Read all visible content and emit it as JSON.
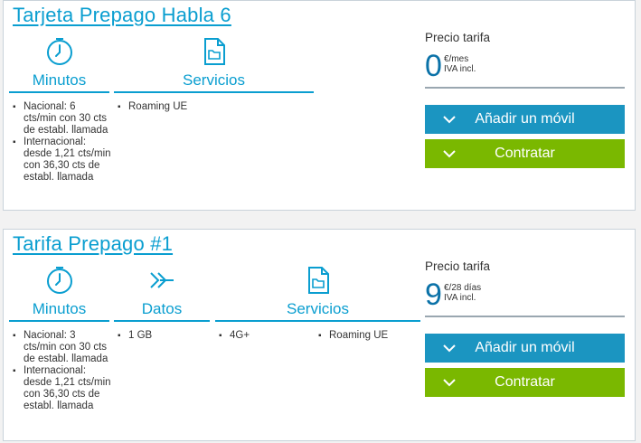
{
  "card1": {
    "title": "Tarjeta Prepago Habla 6",
    "columns": [
      {
        "label": "Minutos",
        "icon": "clock-icon",
        "items": [
          "Nacional: 6 cts/min con 30 cts de establ. llamada",
          "Internacional: desde 1,21 cts/min con 36,30 cts de establ. llamada"
        ]
      },
      {
        "label": "Servicios",
        "icon": "folder-document-icon",
        "items": [
          "Roaming UE"
        ]
      }
    ],
    "price": {
      "label": "Precio tarifa",
      "amount": "0",
      "unit_line1": "€/mes",
      "unit_line2": "IVA incl."
    },
    "buttons": {
      "add_mobile": "Añadir un móvil",
      "contract": "Contratar"
    }
  },
  "card2": {
    "title": "Tarifa Prepago #1",
    "columns": [
      {
        "label": "Minutos",
        "icon": "clock-icon",
        "items": [
          "Nacional: 3 cts/min con 30 cts de establ. llamada",
          "Internacional: desde 1,21 cts/min con 36,30 cts de establ. llamada"
        ]
      },
      {
        "label": "Datos",
        "icon": "data-arrows-icon",
        "items": [
          "1 GB"
        ]
      },
      {
        "label": "Servicios",
        "icon": "folder-document-icon",
        "items": [
          "4G+",
          "Roaming UE"
        ]
      }
    ],
    "price": {
      "label": "Precio tarifa",
      "amount": "9",
      "unit_line1": "€/28 días",
      "unit_line2": "IVA incl."
    },
    "buttons": {
      "add_mobile": "Añadir un móvil",
      "contract": "Contratar"
    }
  },
  "colors": {
    "accent": "#0a9ed0",
    "blue_button": "#1b95c1",
    "green_button": "#7ab800",
    "price": "#0b72a8"
  }
}
